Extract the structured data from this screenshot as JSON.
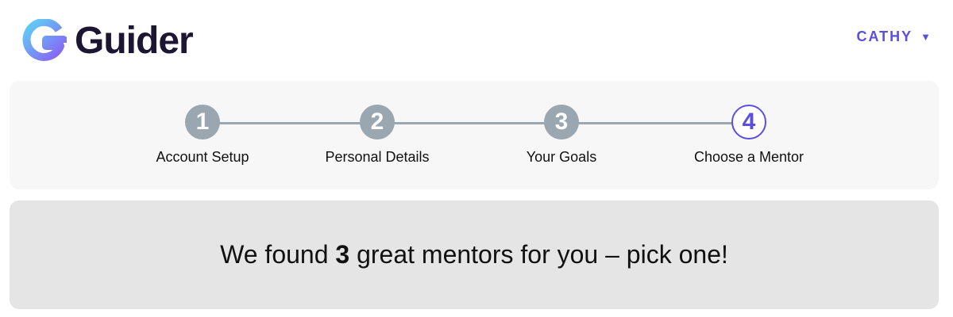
{
  "brand": {
    "logo_icon": "guider-g-logo-icon",
    "name": "Guider"
  },
  "user": {
    "name": "CATHY",
    "caret": "▼"
  },
  "colors": {
    "accent": "#5b4fe0",
    "step_done": "#9aa7b0",
    "logo_gradient_start": "#5dd3f5",
    "logo_gradient_end": "#8a5cf6"
  },
  "steps": [
    {
      "number": "1",
      "label": "Account Setup",
      "state": "complete"
    },
    {
      "number": "2",
      "label": "Personal Details",
      "state": "complete"
    },
    {
      "number": "3",
      "label": "Your Goals",
      "state": "complete"
    },
    {
      "number": "4",
      "label": "Choose a Mentor",
      "state": "active"
    }
  ],
  "banner": {
    "prefix": "We found ",
    "count": "3",
    "suffix": " great mentors for you – pick one!"
  }
}
